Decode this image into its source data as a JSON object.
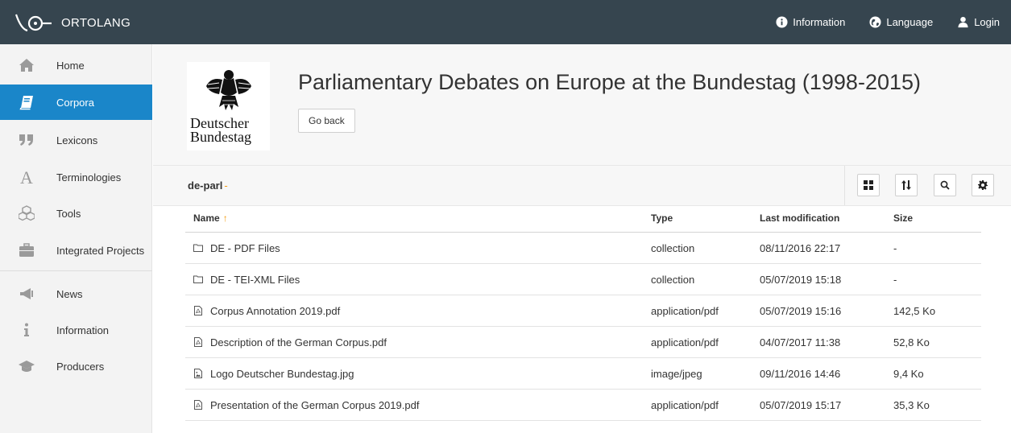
{
  "app": {
    "name": "ORTOLANG",
    "nav": [
      {
        "label": "Information",
        "icon": "info-circle-icon"
      },
      {
        "label": "Language",
        "icon": "globe-icon"
      },
      {
        "label": "Login",
        "icon": "user-icon"
      }
    ]
  },
  "sidebar": {
    "items": [
      {
        "label": "Home",
        "icon": "home-icon"
      },
      {
        "label": "Corpora",
        "icon": "book-icon",
        "active": true
      },
      {
        "label": "Lexicons",
        "icon": "quote-icon"
      },
      {
        "label": "Terminologies",
        "icon": "letter-a-icon"
      },
      {
        "label": "Tools",
        "icon": "cubes-icon"
      },
      {
        "label": "Integrated Projects",
        "icon": "briefcase-icon"
      },
      {
        "label": "News",
        "icon": "megaphone-icon"
      },
      {
        "label": "Information",
        "icon": "info-icon"
      },
      {
        "label": "Producers",
        "icon": "graduation-cap-icon"
      }
    ]
  },
  "header": {
    "logo_text_1": "Deutscher",
    "logo_text_2": "Bundestag",
    "title": "Parliamentary Debates on Europe at the Bundestag (1998-2015)",
    "go_back_label": "Go back"
  },
  "toolbar": {
    "path": "de-parl",
    "path_sep": "-",
    "buttons": [
      "grid-view-icon",
      "sort-icon",
      "search-icon",
      "gear-icon"
    ]
  },
  "table": {
    "columns": {
      "name": "Name",
      "type": "Type",
      "modified": "Last modification",
      "size": "Size"
    },
    "sort_indicator": "↑",
    "rows": [
      {
        "icon": "folder-icon",
        "name": "DE - PDF Files",
        "type": "collection",
        "modified": "08/11/2016 22:17",
        "size": "-"
      },
      {
        "icon": "folder-icon",
        "name": "DE - TEI-XML Files",
        "type": "collection",
        "modified": "05/07/2019 15:18",
        "size": "-"
      },
      {
        "icon": "pdf-file-icon",
        "name": "Corpus Annotation 2019.pdf",
        "type": "application/pdf",
        "modified": "05/07/2019 15:16",
        "size": "142,5 Ko"
      },
      {
        "icon": "pdf-file-icon",
        "name": "Description of the German Corpus.pdf",
        "type": "application/pdf",
        "modified": "04/07/2017 11:38",
        "size": "52,8 Ko"
      },
      {
        "icon": "image-file-icon",
        "name": "Logo Deutscher Bundestag.jpg",
        "type": "image/jpeg",
        "modified": "09/11/2016 14:46",
        "size": "9,4 Ko"
      },
      {
        "icon": "pdf-file-icon",
        "name": "Presentation of the German Corpus 2019.pdf",
        "type": "application/pdf",
        "modified": "05/07/2019 15:17",
        "size": "35,3 Ko"
      }
    ]
  },
  "colors": {
    "topbar": "#36454f",
    "active": "#1a86c9",
    "accent": "#f39c12"
  }
}
